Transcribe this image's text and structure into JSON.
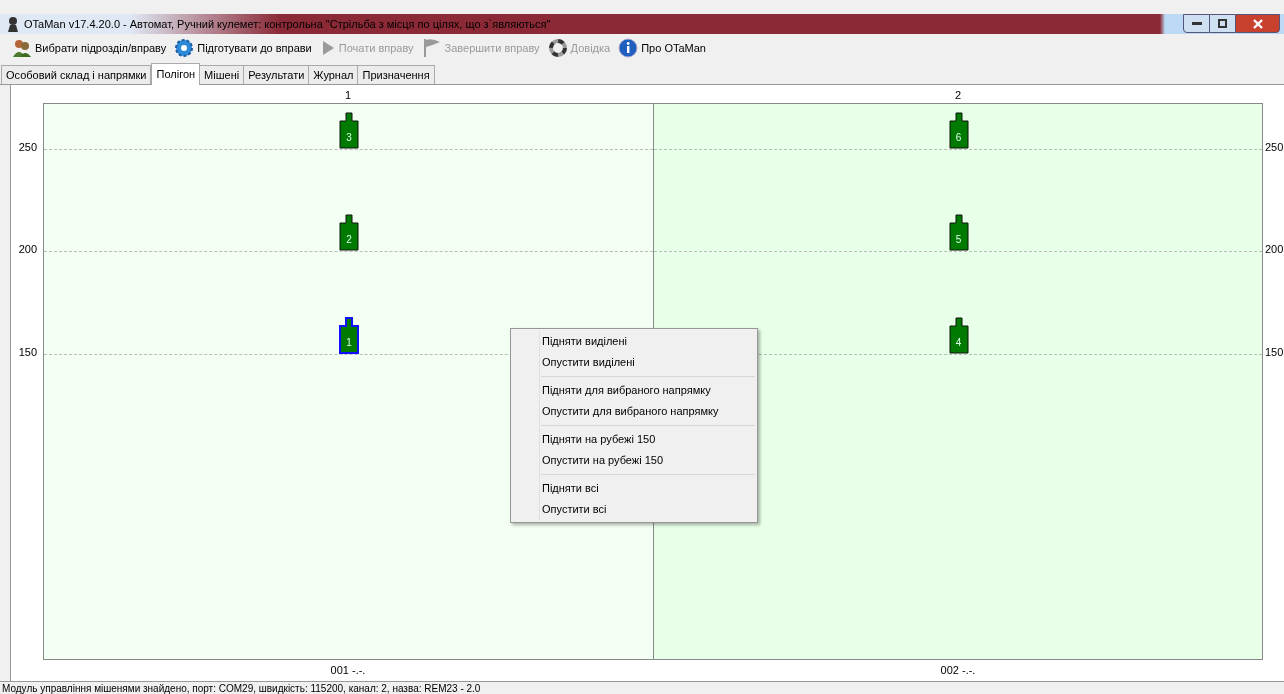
{
  "window": {
    "title": "OTaMan v17.4.20.0 - Автомат, Ручний кулемет: контрольна \"Стрільба з місця по цілях, що з`являються\""
  },
  "toolbar": [
    {
      "kind": "people",
      "label": "Вибрати підрозділ/вправу",
      "disabled": false
    },
    {
      "kind": "gear",
      "label": "Підготувати до вправи",
      "disabled": false
    },
    {
      "kind": "play",
      "label": "Почати вправу",
      "disabled": true
    },
    {
      "kind": "flag",
      "label": "Завершити вправу",
      "disabled": true
    },
    {
      "kind": "help",
      "label": "Довідка",
      "disabled": true
    },
    {
      "kind": "info",
      "label": "Про OTaMan",
      "disabled": false
    }
  ],
  "tabs": [
    {
      "label": "Особовий склад і напрямки",
      "selected": false
    },
    {
      "label": "Полігон",
      "selected": true
    },
    {
      "label": "Мішені",
      "selected": false
    },
    {
      "label": "Результати",
      "selected": false
    },
    {
      "label": "Журнал",
      "selected": false
    },
    {
      "label": "Призначення",
      "selected": false
    }
  ],
  "range_view": {
    "left_axis": [
      "250",
      "200",
      "150"
    ],
    "right_axis": [
      "250",
      "200",
      "150"
    ],
    "lanes": [
      {
        "header": "1",
        "footer": "001 -.-.",
        "targets": [
          {
            "number": "3",
            "selected": false
          },
          {
            "number": "2",
            "selected": false
          },
          {
            "number": "1",
            "selected": true
          }
        ]
      },
      {
        "header": "2",
        "footer": "002 -.-.",
        "targets": [
          {
            "number": "6",
            "selected": false
          },
          {
            "number": "5",
            "selected": false
          },
          {
            "number": "4",
            "selected": false
          }
        ]
      }
    ]
  },
  "context_menu": [
    [
      "Підняти виділені",
      "Опустити виділені"
    ],
    [
      "Підняти для вибраного напрямку",
      "Опустити для вибраного напрямку"
    ],
    [
      "Підняти на рубежі 150",
      "Опустити на рубежі 150"
    ],
    [
      "Підняти всі",
      "Опустити всі"
    ]
  ],
  "status_bar": "Модуль управління мішенями знайдено, порт: COM29, швидкість: 115200, канал: 2, назва: REM23 - 2.0"
}
